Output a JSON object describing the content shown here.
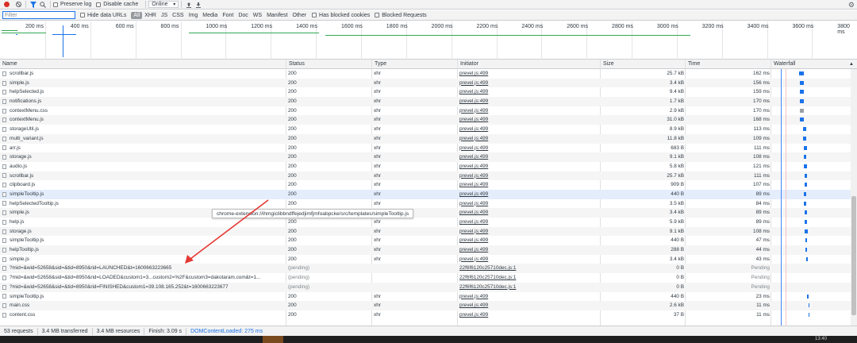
{
  "toolbar": {
    "preserve_log": "Preserve log",
    "disable_cache": "Disable cache",
    "throttle": "Online"
  },
  "filterbar": {
    "filter_placeholder": "Filter",
    "hide_data_urls": "Hide data URLs",
    "types": [
      "All",
      "XHR",
      "JS",
      "CSS",
      "Img",
      "Media",
      "Font",
      "Doc",
      "WS",
      "Manifest",
      "Other"
    ],
    "has_blocked_cookies": "Has blocked cookies",
    "blocked_requests": "Blocked Requests"
  },
  "overview": {
    "ticks": [
      "200 ms",
      "400 ms",
      "600 ms",
      "800 ms",
      "1000 ms",
      "1200 ms",
      "1400 ms",
      "1600 ms",
      "1800 ms",
      "2000 ms",
      "2200 ms",
      "2400 ms",
      "2600 ms",
      "2800 ms",
      "3000 ms",
      "3200 ms",
      "3400 ms",
      "3600 ms",
      "3800 ms"
    ]
  },
  "columns": {
    "name": "Name",
    "status": "Status",
    "type": "Type",
    "initiator": "Initiator",
    "size": "Size",
    "time": "Time",
    "waterfall": "Waterfall"
  },
  "rows": [
    {
      "name": "scrollbar.js",
      "status": "200",
      "type": "xhr",
      "initiator": "prevel.js:499",
      "size": "25.7 kB",
      "time": "162 ms"
    },
    {
      "name": "simple.js",
      "status": "200",
      "type": "xhr",
      "initiator": "prevel.js:499",
      "size": "3.4 kB",
      "time": "156 ms"
    },
    {
      "name": "helpSelected.js",
      "status": "200",
      "type": "xhr",
      "initiator": "prevel.js:499",
      "size": "9.4 kB",
      "time": "159 ms"
    },
    {
      "name": "notifications.js",
      "status": "200",
      "type": "xhr",
      "initiator": "prevel.js:499",
      "size": "1.7 kB",
      "time": "170 ms"
    },
    {
      "name": "contextMenu.css",
      "status": "200",
      "type": "xhr",
      "initiator": "prevel.js:499",
      "size": "2.9 kB",
      "time": "170 ms"
    },
    {
      "name": "contextMenu.js",
      "status": "200",
      "type": "xhr",
      "initiator": "prevel.js:499",
      "size": "31.0 kB",
      "time": "168 ms"
    },
    {
      "name": "storageUtil.js",
      "status": "200",
      "type": "xhr",
      "initiator": "prevel.js:499",
      "size": "8.9 kB",
      "time": "113 ms"
    },
    {
      "name": "multi_variant.js",
      "status": "200",
      "type": "xhr",
      "initiator": "prevel.js:499",
      "size": "11.8 kB",
      "time": "109 ms"
    },
    {
      "name": "arr.js",
      "status": "200",
      "type": "xhr",
      "initiator": "prevel.js:499",
      "size": "683 B",
      "time": "111 ms"
    },
    {
      "name": "storage.js",
      "status": "200",
      "type": "xhr",
      "initiator": "prevel.js:499",
      "size": "9.1 kB",
      "time": "108 ms"
    },
    {
      "name": "audio.js",
      "status": "200",
      "type": "xhr",
      "initiator": "prevel.js:499",
      "size": "5.8 kB",
      "time": "121 ms"
    },
    {
      "name": "scrollbar.js",
      "status": "200",
      "type": "xhr",
      "initiator": "prevel.js:499",
      "size": "25.7 kB",
      "time": "111 ms"
    },
    {
      "name": "clipboard.js",
      "status": "200",
      "type": "xhr",
      "initiator": "prevel.js:499",
      "size": "909 B",
      "time": "107 ms"
    },
    {
      "name": "simpleTooltip.js",
      "status": "200",
      "type": "xhr",
      "initiator": "prevel.js:499",
      "size": "440 B",
      "time": "89 ms"
    },
    {
      "name": "helpSelectedTooltip.js",
      "status": "200",
      "type": "xhr",
      "initiator": "prevel.js:499",
      "size": "3.5 kB",
      "time": "84 ms"
    },
    {
      "name": "simple.js",
      "status": "200",
      "type": "xhr",
      "initiator": "prevel.js:499",
      "size": "3.4 kB",
      "time": "89 ms"
    },
    {
      "name": "help.js",
      "status": "200",
      "type": "xhr",
      "initiator": "prevel.js:499",
      "size": "5.9 kB",
      "time": "89 ms"
    },
    {
      "name": "storage.js",
      "status": "200",
      "type": "xhr",
      "initiator": "prevel.js:499",
      "size": "9.1 kB",
      "time": "108 ms"
    },
    {
      "name": "simpleTooltip.js",
      "status": "200",
      "type": "xhr",
      "initiator": "prevel.js:499",
      "size": "440 B",
      "time": "47 ms"
    },
    {
      "name": "helpTooltip.js",
      "status": "200",
      "type": "xhr",
      "initiator": "prevel.js:499",
      "size": "288 B",
      "time": "44 ms"
    },
    {
      "name": "simple.js",
      "status": "200",
      "type": "xhr",
      "initiator": "prevel.js:499",
      "size": "3.4 kB",
      "time": "43 ms"
    },
    {
      "name": "?mid=&wid=52658&sid=&tid=8950&rid=LAUNCHED&t=1600663223665",
      "status": "(pending)",
      "type": "",
      "initiator": "22f6f6120c25710dec.js:1",
      "size": "0 B",
      "time": "Pending"
    },
    {
      "name": "?mid=&wid=52658&sid=&tid=8950&rid=LOADED&custom1=3...custom2=%2F&custom3=dakotaram.com&t=1...",
      "status": "(pending)",
      "type": "",
      "initiator": "22f6f6120c25710dec.js:1",
      "size": "0 B",
      "time": "Pending"
    },
    {
      "name": "?mid=&wid=52658&sid=&tid=8950&rid=FINISHED&custom1=39.108.165.252&t=1600663223677",
      "status": "(pending)",
      "type": "",
      "initiator": "22f6f6120c25710dec.js:1",
      "size": "0 B",
      "time": "Pending"
    },
    {
      "name": "simpleTooltip.js",
      "status": "200",
      "type": "xhr",
      "initiator": "prevel.js:499",
      "size": "440 B",
      "time": "23 ms"
    },
    {
      "name": "main.css",
      "status": "200",
      "type": "xhr",
      "initiator": "prevel.js:499",
      "size": "2.6 kB",
      "time": "11 ms"
    },
    {
      "name": "content.css",
      "status": "200",
      "type": "xhr",
      "initiator": "prevel.js:499",
      "size": "37 B",
      "time": "11 ms"
    }
  ],
  "tooltip": "chrome-extension://ihmgiclibbndffejedjimfjmfoabpcke/src/templates/simpleTooltip.js",
  "statusbar": {
    "requests": "53 requests",
    "transferred": "3.4 MB transferred",
    "resources": "3.4 MB resources",
    "finish": "Finish: 3.09 s",
    "dcl": "DOMContentLoaded: 275 ms"
  },
  "taskbar": {
    "clock": "13:40"
  },
  "colors": {
    "waterfall_bar": "#1a73e8",
    "waterfall_gray": "#9aa0a6",
    "arrow": "#e53935",
    "overview_green": "#34a853"
  }
}
